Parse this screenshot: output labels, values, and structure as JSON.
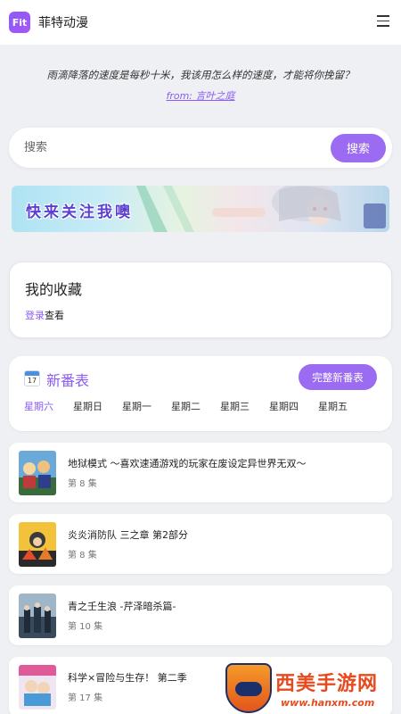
{
  "header": {
    "logo_text": "Fit",
    "app_name": "菲特动漫"
  },
  "quote": {
    "text": "雨滴降落的速度是每秒十米，我该用怎么样的速度，才能将你挽留？",
    "source": "from: 言叶之庭"
  },
  "search": {
    "placeholder": "搜索",
    "button_label": "搜索"
  },
  "banner": {
    "text": "快来关注我噢"
  },
  "favorites": {
    "title": "我的收藏",
    "login_link": "登录",
    "login_suffix": "查看"
  },
  "schedule": {
    "calendar_number": "17",
    "title": "新番表",
    "full_button": "完整新番表",
    "days": [
      "星期六",
      "星期日",
      "星期一",
      "星期二",
      "星期三",
      "星期四",
      "星期五"
    ],
    "active_day": "星期六"
  },
  "anime_list": [
    {
      "title": "地狱模式 ～喜欢速通游戏的玩家在废设定异世界无双～",
      "episode": "第 8 集"
    },
    {
      "title": "炎炎消防队 三之章 第2部分",
      "episode": "第 8 集"
    },
    {
      "title": "青之壬生浪 -芹泽暗杀篇-",
      "episode": "第 10 集"
    },
    {
      "title": "科学×冒险与生存！ 第二季",
      "episode": "第 17 集"
    }
  ],
  "watermark": {
    "name": "西美手游网",
    "url": "www.hanxm.com"
  },
  "colors": {
    "accent": "#9b6cf2",
    "background": "#eef0f3"
  }
}
